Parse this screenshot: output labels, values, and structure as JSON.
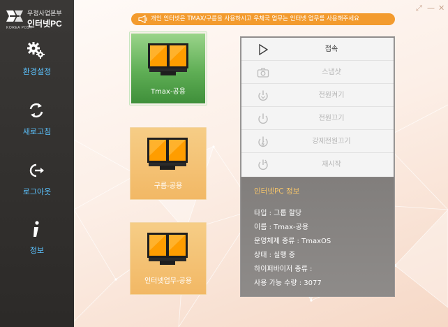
{
  "brand": {
    "org": "우정사업본부",
    "title": "인터넷PC",
    "sub": "KOREA POST"
  },
  "sidebar": {
    "items": [
      {
        "label": "환경설정",
        "icon": "gears-icon"
      },
      {
        "label": "새로고침",
        "icon": "refresh-icon"
      },
      {
        "label": "로그아웃",
        "icon": "logout-icon"
      },
      {
        "label": "정보",
        "icon": "info-icon"
      }
    ]
  },
  "window": {
    "restore": "⤢",
    "minimize": "—",
    "close": "✕"
  },
  "notice": {
    "text": "개인 인터넷은 TMAX/구름을 사용하시고 우체국 업무는 인터넷 업무를 사용해주세요",
    "icon": "megaphone-icon"
  },
  "tiles": [
    {
      "label": "Tmax-공용",
      "state": "active"
    },
    {
      "label": "구름-공용",
      "state": "idle"
    },
    {
      "label": "인터넷업무-공용",
      "state": "idle"
    }
  ],
  "actions": [
    {
      "label": "접속",
      "icon": "play-icon",
      "enabled": true
    },
    {
      "label": "스냅샷",
      "icon": "camera-icon",
      "enabled": false
    },
    {
      "label": "전원켜기",
      "icon": "power-on-icon",
      "enabled": false
    },
    {
      "label": "전원끄기",
      "icon": "power-off-icon",
      "enabled": false
    },
    {
      "label": "강제전원끄기",
      "icon": "force-power-off-icon",
      "enabled": false
    },
    {
      "label": "재시작",
      "icon": "restart-icon",
      "enabled": false
    }
  ],
  "info": {
    "title": "인터넷PC 정보",
    "type": "타입 : 그룹 할당",
    "name": "이름 : Tmax-공용",
    "os": "운영체제 종류 : TmaxOS",
    "status": "상태 : 실행 중",
    "hypervisor": "하이퍼바이저 종류 :",
    "available": "사용 가능 수량 : 3077"
  },
  "colors": {
    "sidebar": "#2f2d2b",
    "nav_label": "#5cc3ff",
    "notice": "#f39b2e",
    "tile_active": "#5fae55",
    "tile_idle": "#f2b865",
    "info_title": "#f5c46a"
  }
}
